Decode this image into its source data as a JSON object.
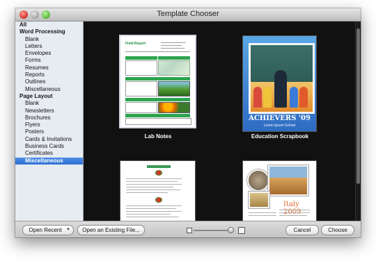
{
  "window": {
    "title": "Template Chooser"
  },
  "sidebar": {
    "items": [
      {
        "label": "All",
        "type": "header"
      },
      {
        "label": "Word Processing",
        "type": "header"
      },
      {
        "label": "Blank",
        "type": "item"
      },
      {
        "label": "Letters",
        "type": "item"
      },
      {
        "label": "Envelopes",
        "type": "item"
      },
      {
        "label": "Forms",
        "type": "item"
      },
      {
        "label": "Resumes",
        "type": "item"
      },
      {
        "label": "Reports",
        "type": "item"
      },
      {
        "label": "Outlines",
        "type": "item"
      },
      {
        "label": "Miscellaneous",
        "type": "item"
      },
      {
        "label": "Page Layout",
        "type": "header"
      },
      {
        "label": "Blank",
        "type": "item"
      },
      {
        "label": "Newsletters",
        "type": "item"
      },
      {
        "label": "Brochures",
        "type": "item"
      },
      {
        "label": "Flyers",
        "type": "item"
      },
      {
        "label": "Posters",
        "type": "item"
      },
      {
        "label": "Cards & Invitations",
        "type": "item"
      },
      {
        "label": "Business Cards",
        "type": "item"
      },
      {
        "label": "Certificates",
        "type": "item"
      },
      {
        "label": "Miscellaneous",
        "type": "item",
        "selected": true
      }
    ]
  },
  "templates": [
    {
      "label": "Lab Notes",
      "doc_title": "Field Report"
    },
    {
      "label": "Education Scrapbook",
      "headline": "ACHIEVERS '09",
      "subline": "Lorem Ipsum School"
    },
    {
      "label": ""
    },
    {
      "label": "",
      "headline": "Italy 2009"
    }
  ],
  "bottombar": {
    "open_recent": "Open Recent",
    "open_existing": "Open an Existing File...",
    "cancel": "Cancel",
    "choose": "Choose",
    "zoom_level": 0.95
  },
  "colors": {
    "selection": "#2d6fd0",
    "content_bg": "#111111",
    "lab_green": "#2ea44f",
    "italy_orange": "#e06a2a"
  }
}
